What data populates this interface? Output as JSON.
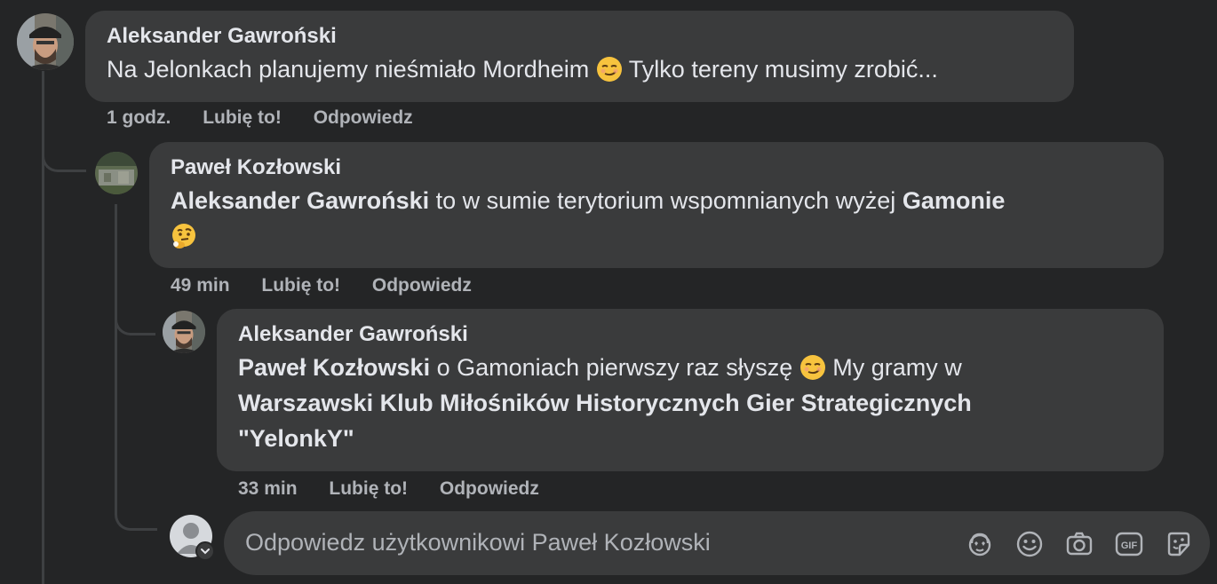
{
  "comments": [
    {
      "author": "Aleksander Gawroński",
      "text_before": "Na Jelonkach planujemy nieśmiało Mordheim",
      "text_after": "Tylko tereny musimy zrobić...",
      "time": "1 godz.",
      "like": "Lubię to!",
      "reply": "Odpowiedz"
    },
    {
      "author": "Paweł Kozłowski",
      "mention": "Aleksander Gawroński",
      "text_middle": "to w sumie terytorium wspomnianych wyżej",
      "mention2": "Gamonie",
      "time": "49 min",
      "like": "Lubię to!",
      "reply": "Odpowiedz"
    },
    {
      "author": "Aleksander Gawroński",
      "mention": "Paweł Kozłowski",
      "text_middle": "o Gamoniach pierwszy raz słyszę",
      "text_after": "My gramy w",
      "mention2": "Warszawski Klub Miłośników Historycznych Gier Strategicznych \"YelonkY\"",
      "time": "33 min",
      "like": "Lubię to!",
      "reply": "Odpowiedz"
    }
  ],
  "reply_input": {
    "placeholder": "Odpowiedz użytkownikowi Paweł Kozłowski"
  },
  "icons": [
    "avatar-sticker-icon",
    "emoji-icon",
    "camera-icon",
    "gif-icon",
    "sticker-icon"
  ],
  "colors": {
    "background": "#242526",
    "bubble": "#3a3b3c",
    "secondary_text": "#b0b3b8"
  }
}
